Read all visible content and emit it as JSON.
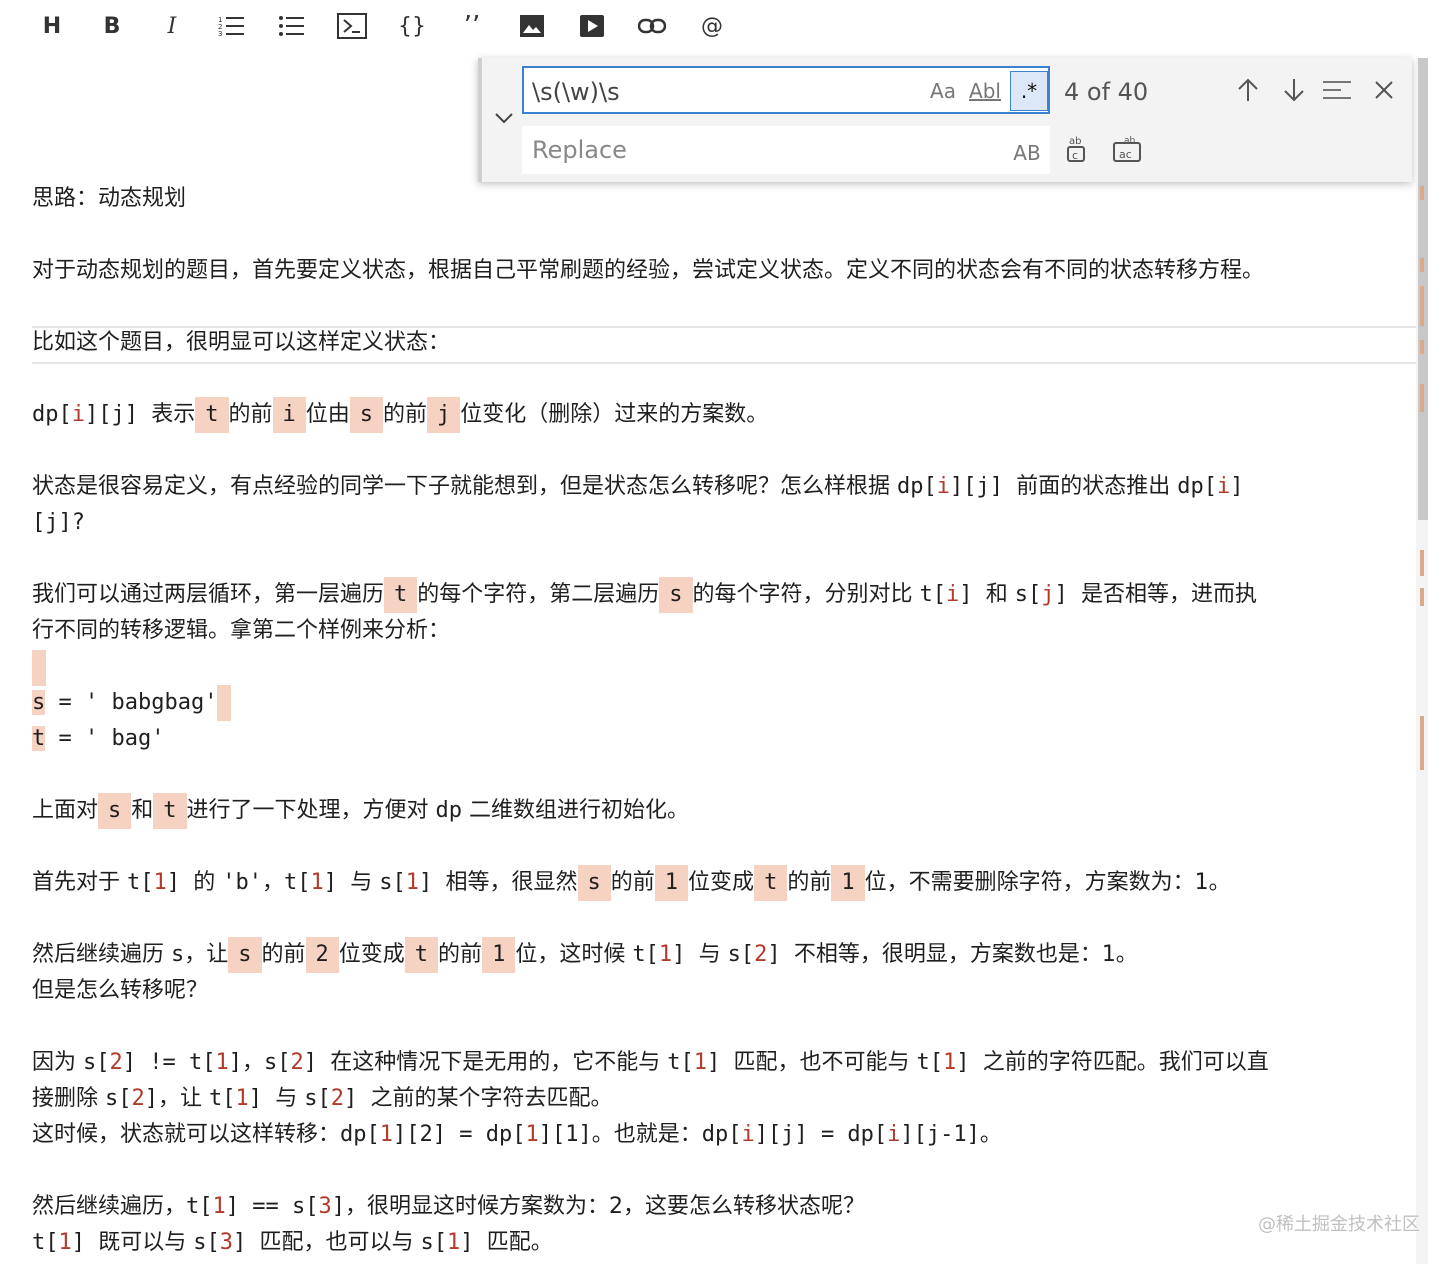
{
  "toolbar": {
    "heading": "H",
    "bold": "B",
    "italic": "I",
    "ordered_list": "1≡",
    "unordered_list": "•≡",
    "code_block": "▷",
    "braces": "{}",
    "quote": "’’",
    "image": "▣",
    "video": "▶",
    "link": "∞",
    "mention": "@"
  },
  "find": {
    "query": "\\s(\\w)\\s",
    "case_option": "Aa",
    "word_option": "Abl",
    "regex_option": ".*",
    "replace_placeholder": "Replace",
    "preserve_case": "AB",
    "count": "4 of 40"
  },
  "content": {
    "line1": "思路：动态规划",
    "line2": "对于动态规划的题目，首先要定义状态，根据自己平常刷题的经验，尝试定义状态。定义不同的状态会有不同的状态转移方程。",
    "line3": "比如这个题目，很明显可以这样定义状态：",
    "l4": {
      "a": "dp[",
      "b": "i",
      "c": "][j] ",
      "d": "表示",
      "e": "t",
      "f": "的前",
      "g": "i",
      "h": "位由",
      "i": "s",
      "j": "的前",
      "k": "j",
      "l": "位变化（删除）过来的方案数。"
    },
    "l5": {
      "a": "状态是很容易定义，有点经验的同学一下子就能想到，但是状态怎么转移呢？怎么样根据 ",
      "b": "dp[",
      "c": "i",
      "d": "][j] ",
      "e": "前面的状态推出 ",
      "f": "dp[",
      "g": "i",
      "h": "]"
    },
    "l5b": "[j]?",
    "l6": {
      "a": "我们可以通过两层循环，第一层遍历",
      "b": "t",
      "c": "的每个字符，第二层遍历",
      "d": "s",
      "e": "的每个字符，分别对比 ",
      "f": "t[",
      "g": "i",
      "h": "] ",
      "i": "和 ",
      "j": "s[",
      "k": "j",
      "l": "] ",
      "m": "是否相等，进而执"
    },
    "l6b": "行不同的转移逻辑。拿第二个样例来分析：",
    "s_line": {
      "a": "s",
      "b": " = ' babgbag'"
    },
    "t_line": {
      "a": "t",
      "b": " = ' bag'"
    },
    "l7": {
      "a": "上面对",
      "b": "s",
      "c": "和",
      "d": "t",
      "e": "进行了一下处理，方便对 ",
      "f": "dp",
      "g": " 二维数组进行初始化。"
    },
    "l8": {
      "a": "首先对于 ",
      "b": "t[",
      "c": "1",
      "d": "] ",
      "e": "的 ",
      "f": "'b'",
      "g": "，",
      "h": "t[",
      "i": "1",
      "j": "] ",
      "k": "与 ",
      "l": "s[",
      "m": "1",
      "n": "] ",
      "o": "相等，很显然",
      "p": "s",
      "q": "的前",
      "r": "1",
      "s": "位变成",
      "t": "t",
      "u": "的前",
      "v": "1",
      "w": "位，不需要删除字符，方案数为：1。"
    },
    "l9": {
      "a": "然后继续遍历 ",
      "b": "s",
      "c": "，让",
      "d": "s",
      "e": "的前",
      "f": "2",
      "g": "位变成",
      "h": "t",
      "i": "的前",
      "j": "1",
      "k": "位，这时候 ",
      "l": "t[",
      "m": "1",
      "n": "] ",
      "o": "与 ",
      "p": "s[",
      "q": "2",
      "r": "] ",
      "s": "不相等，很明显，方案数也是：1。"
    },
    "l9b": "但是怎么转移呢？",
    "l10": {
      "a": "因为 ",
      "b": "s[",
      "c": "2",
      "d": "] != t[",
      "e": "1",
      "f": "]",
      "g": "，",
      "h": "s[",
      "i": "2",
      "j": "] ",
      "k": "在这种情况下是无用的，它不能与 ",
      "l": "t[",
      "m": "1",
      "n": "] ",
      "o": "匹配，也不可能与 ",
      "p": "t[",
      "q": "1",
      "r": "] ",
      "s": "之前的字符匹配。我们可以直"
    },
    "l10b": {
      "a": "接删除 ",
      "b": "s[",
      "c": "2",
      "d": "]",
      "e": "，让 ",
      "f": "t[",
      "g": "1",
      "h": "] ",
      "i": "与 ",
      "j": "s[",
      "k": "2",
      "l": "] ",
      "m": "之前的某个字符去匹配。"
    },
    "l10c": {
      "a": "这时候，状态就可以这样转移：",
      "b": "dp[",
      "c": "1",
      "d": "][2] = dp[",
      "e": "1",
      "f": "][1]",
      "g": "。也就是：",
      "h": "dp[",
      "i": "i",
      "j": "][j] = dp[",
      "k": "i",
      "l": "][j-1]",
      "m": "。"
    },
    "l11": {
      "a": "然后继续遍历，",
      "b": "t[",
      "c": "1",
      "d": "] == s[",
      "e": "3",
      "f": "]",
      "g": "，很明显这时候方案数为：2，这要怎么转移状态呢？"
    },
    "l11b": {
      "a": "t[",
      "b": "1",
      "c": "] ",
      "d": "既可以与 ",
      "e": "s[",
      "f": "3",
      "g": "] ",
      "h": "匹配，也可以与 ",
      "i": "s[",
      "j": "1",
      "k": "] ",
      "l": "匹配。"
    }
  },
  "watermark": "@稀土掘金技术社区"
}
